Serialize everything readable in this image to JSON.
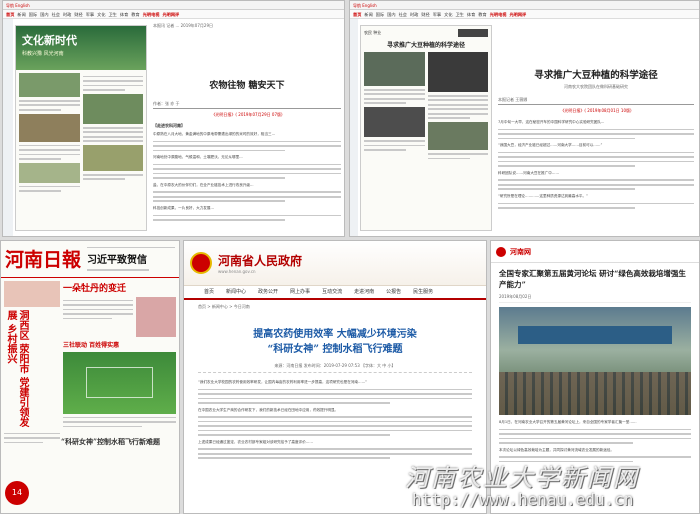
{
  "panels": {
    "top_left": {
      "topbar": "导航 English",
      "nav": [
        "首页",
        "新闻",
        "国际",
        "国内",
        "社会",
        "时政",
        "财经",
        "军事",
        "文化",
        "卫生",
        "体育",
        "教育",
        "光明电视",
        "光明网评"
      ],
      "thumb_masthead": "文化新时代",
      "thumb_subtitle": "科教兴豫 风光河南",
      "meta": "本报讯 记者 ... 2019年07月29日",
      "title": "农物往物 糖安天下",
      "source_label": "作者：张 亦 于",
      "date": "《光明日报》( 2019年07月29日 07版)",
      "section": "【走进农科河南】",
      "paras": [
        "中原熟在八月大地，黄金满地的中原地带需遭出绿的的米时的效好，相当三...",
        "河南地处中原腹地，气候温和，土壤肥沃。无论从哪里...",
        "盐，在中原农大的伙伴们们，在全产业链技术上进行改良升级...",
        "科技创新成果，一片良好，大力发展..."
      ]
    },
    "top_right": {
      "topbar": "导航 English",
      "nav": [
        "首页",
        "新闻",
        "国际",
        "国内",
        "社会",
        "时政",
        "财经",
        "军事",
        "文化",
        "卫生",
        "体育",
        "教育",
        "光明电视",
        "光明网评"
      ],
      "thumb_title": "寻求推广大豆种植的科学途径",
      "thumb_heading": "农民 种业",
      "title": "寻求推广大豆种植的科学途径",
      "subtitle": "河南农大农院团队在做科研基础研究",
      "meta": "本报记者 王薇娜",
      "date": "《光明日报》( 2019年08月01日 10版)",
      "paras": [
        "7月中旬一大早，这在秘密开车的中国科学研究中心实验研究团队...",
        "“我国大豆，经济产业链已经超过……河南大学……目前可以……”",
        "科研团队说……河南大豆在推广中……",
        "“研究所是在理论…………这里种质资源达到最高水平。”"
      ]
    },
    "bottom_left": {
      "masthead": "河南日報",
      "banner": "习近平致贺信",
      "headline_vertical": "洞西区 荥阳市 党建引领发展 乡村振兴",
      "headline_big": "一朵牡丹的变迁",
      "section_red": "三社联动 百姓得实惠",
      "caption": "“科研女神”控制水稻飞行新难题",
      "page_num": "14"
    },
    "bottom_mid": {
      "site_title": "河南省人民政府",
      "site_sub": "www.henan.gov.cn",
      "nav": [
        "首页",
        "新闻中心",
        "政务公开",
        "网上办事",
        "互动交流",
        "走进河南",
        "公报告",
        "民生服务"
      ],
      "breadcrumb": "首页 > 新闻中心 > 今日河南",
      "headline_1": "提高农药使用效率 大幅减少环境污染",
      "headline_2": "“科研女神” 控制水稻飞行难题",
      "meta": "来源：河南日报  发布时间：2019-07-29 07:53  【字体：大 中 小】",
      "paras": [
        "“我们农业大学校园的农药使用效率研发，让国内每亩的农药利用率进一步提高，这项研究也是在河南……”",
        "在中国农业大学生产商的合作研发下，我们的新技术已经在田地中应用，药效提升明显。",
        "上述成果已经通过鉴定，农业农村部专家组对该研究给予了高度评价……"
      ]
    },
    "bottom_right": {
      "site_title": "河南网",
      "title": "全国专家汇聚第五届黄河论坛 研讨“绿色高效栽培增强生产能力”",
      "date": "2019年08月02日",
      "paras": [
        "8月1日，在河南农业大学召开的第五届黄河论坛上，来自全国的专家学者汇聚一堂……",
        "本次论坛以绿色高效栽培为主题，共同探讨黄河流域农业发展的新途径。"
      ]
    }
  },
  "watermark": {
    "text": "河南农业大学新闻网",
    "url": "http://www.henau.edu.cn"
  },
  "colors": {
    "accent_red": "#c00000",
    "gov_red": "#b30000"
  }
}
